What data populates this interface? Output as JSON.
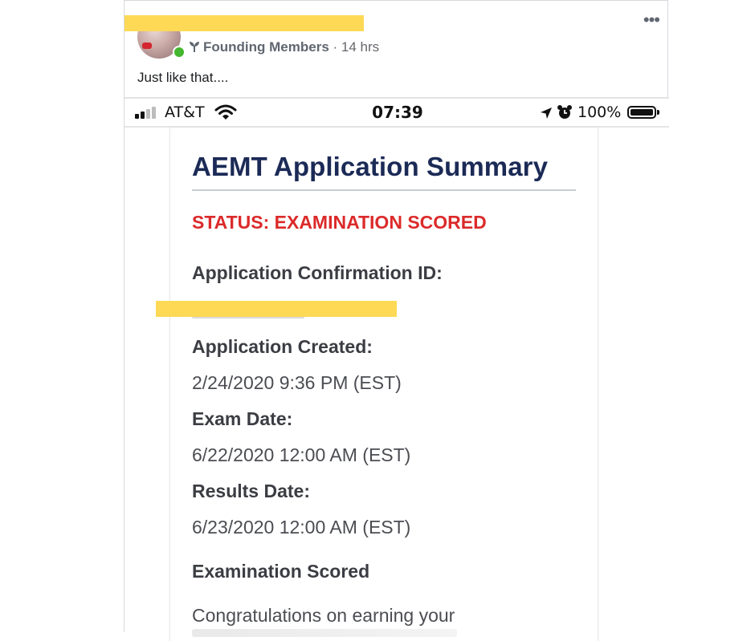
{
  "post": {
    "author_name": "",
    "group_name": "Founding Members",
    "time_ago": "· 14 hrs",
    "text": "Just like that....",
    "more_label": "•••",
    "group_icon": "sprout-icon",
    "online_color": "#44b62f",
    "redaction_color": "#fdd956"
  },
  "phone_status": {
    "carrier": "AT&T",
    "time": "07:39",
    "battery": "100%",
    "icons": [
      "signal-icon",
      "wifi-icon",
      "location-icon",
      "alarm-icon",
      "battery-icon"
    ]
  },
  "document": {
    "title": "AEMT Application Summary",
    "status": "STATUS: EXAMINATION SCORED",
    "status_color": "#dc2a2a",
    "title_color": "#1b2a56",
    "fields": [
      {
        "label": "Application Confirmation ID:",
        "value": ""
      },
      {
        "label": "Application Created:",
        "value": "2/24/2020 9:36 PM (EST)"
      },
      {
        "label": "Exam Date:",
        "value": "6/22/2020 12:00 AM (EST)"
      },
      {
        "label": "Results Date:",
        "value": "6/23/2020 12:00 AM (EST)"
      }
    ],
    "section_heading": "Examination Scored",
    "body_text": "Congratulations on earning your"
  }
}
